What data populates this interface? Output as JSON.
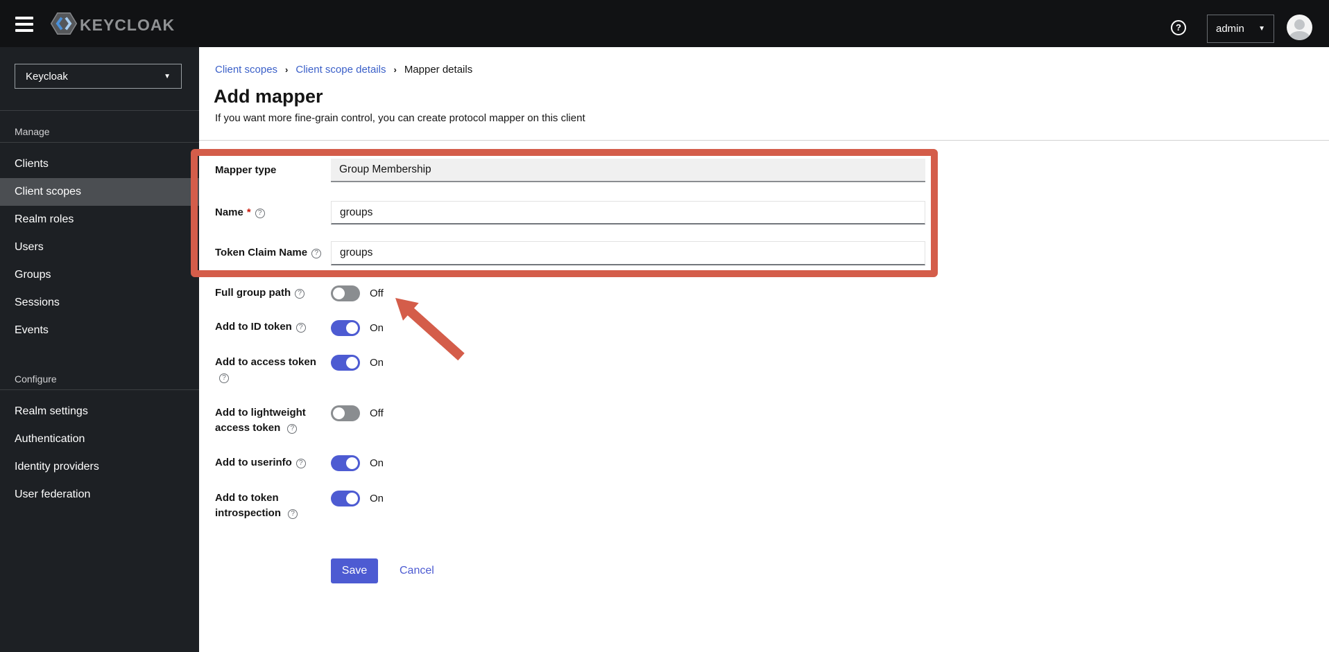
{
  "header": {
    "brand": "KEYCLOAK",
    "user_label": "admin"
  },
  "sidebar": {
    "realm_selector": "Keycloak",
    "sections": [
      {
        "title": "Manage",
        "items": [
          "Clients",
          "Client scopes",
          "Realm roles",
          "Users",
          "Groups",
          "Sessions",
          "Events"
        ],
        "selected_item": "Client scopes"
      },
      {
        "title": "Configure",
        "items": [
          "Realm settings",
          "Authentication",
          "Identity providers",
          "User federation"
        ]
      }
    ]
  },
  "breadcrumb": {
    "items": [
      "Client scopes",
      "Client scope details",
      "Mapper details"
    ]
  },
  "page": {
    "title": "Add mapper",
    "subtitle": "If you want more fine-grain control, you can create protocol mapper on this client"
  },
  "form": {
    "rows": [
      {
        "label": "Mapper type",
        "value": "Group Membership"
      },
      {
        "label": "Name",
        "required_mark": "*",
        "value": "groups"
      },
      {
        "label": "Token Claim Name",
        "value": "groups"
      },
      {
        "label": "Full group path",
        "state": "off",
        "state_label": "Off"
      },
      {
        "label": "Add to ID token",
        "state": "on",
        "state_label": "On"
      },
      {
        "label": "Add to access token",
        "state": "on",
        "state_label": "On"
      },
      {
        "label": "Add to lightweight access token",
        "state": "off",
        "state_label": "Off"
      },
      {
        "label": "Add to userinfo",
        "state": "on",
        "state_label": "On"
      },
      {
        "label": "Add to token introspection",
        "state": "on",
        "state_label": "On"
      }
    ],
    "save_label": "Save",
    "cancel_label": "Cancel"
  },
  "colors": {
    "accent": "#4d5bd2",
    "link_blue": "#3a5fc8",
    "annotation_red": "#d45d4a",
    "header_bg": "#111214",
    "sidebar_bg": "#1d2024",
    "selected_nav_bg": "#4b4e52"
  }
}
